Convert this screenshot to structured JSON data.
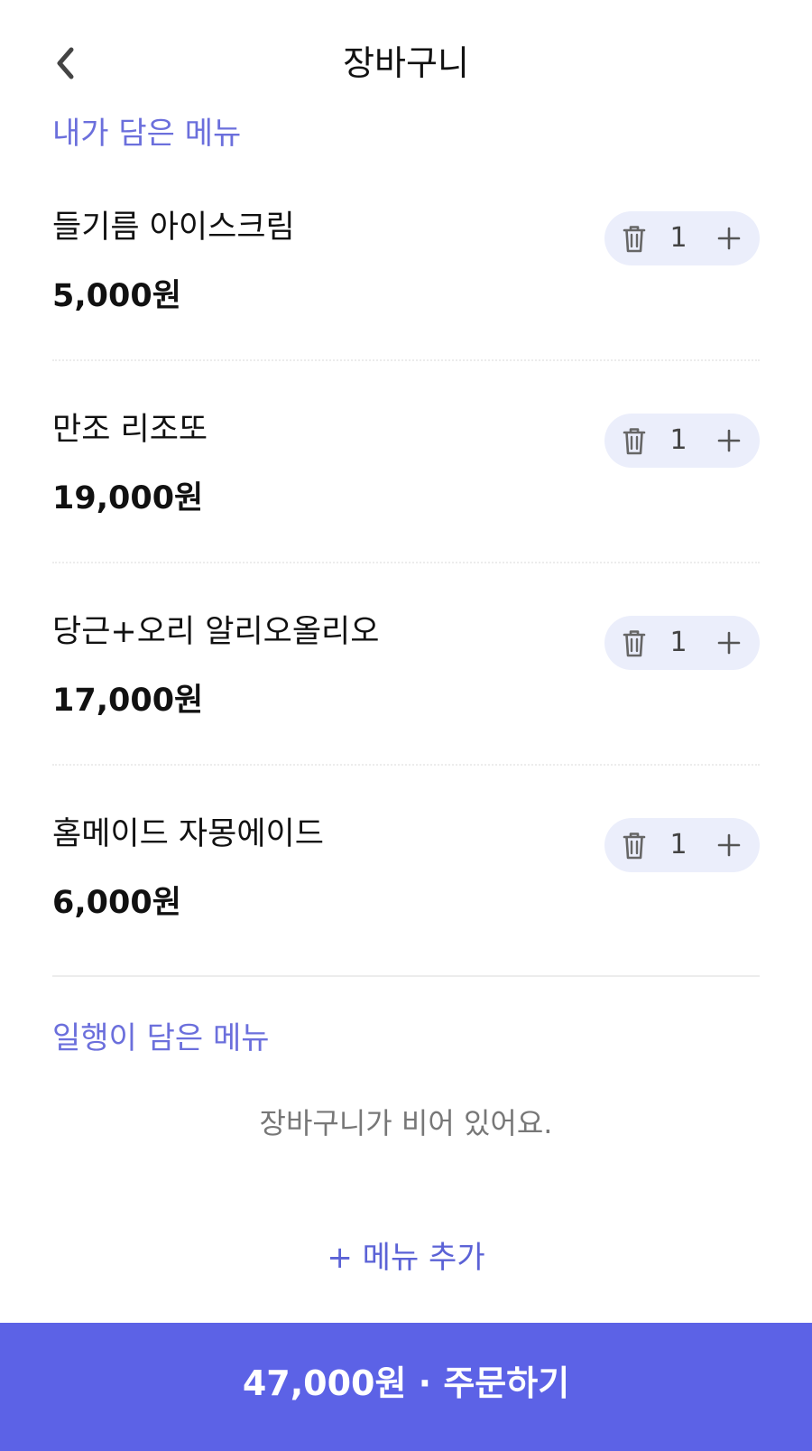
{
  "header": {
    "title": "장바구니"
  },
  "my_menu": {
    "section_title": "내가 담은 메뉴",
    "items": [
      {
        "name": "들기름 아이스크림",
        "price": "5,000원",
        "quantity": "1"
      },
      {
        "name": "만조 리조또",
        "price": "19,000원",
        "quantity": "1"
      },
      {
        "name": "당근+오리 알리오올리오",
        "price": "17,000원",
        "quantity": "1"
      },
      {
        "name": "홈메이드 자몽에이드",
        "price": "6,000원",
        "quantity": "1"
      }
    ]
  },
  "companion_menu": {
    "section_title": "일행이 담은 메뉴",
    "empty_text": "장바구니가 비어 있어요."
  },
  "add_menu_label": "+ 메뉴 추가",
  "order": {
    "label": "47,000원 · 주문하기"
  },
  "icons": {
    "back": "chevron-left-icon",
    "delete": "trash-icon",
    "increment": "plus-icon"
  },
  "colors": {
    "accent": "#5c62e6",
    "section_title": "#6b6fdc",
    "stepper_bg": "#ebeefb"
  }
}
